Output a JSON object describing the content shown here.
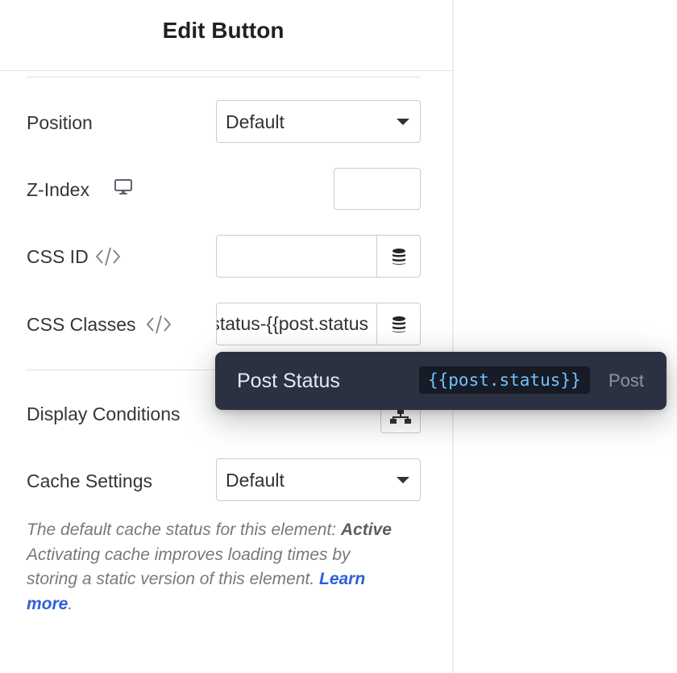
{
  "panel": {
    "title": "Edit Button"
  },
  "fields": {
    "position": {
      "label": "Position",
      "value": "Default"
    },
    "z_index": {
      "label": "Z-Index",
      "value": ""
    },
    "css_id": {
      "label": "CSS ID",
      "value": ""
    },
    "css_classes": {
      "label": "CSS Classes",
      "value": "status-{{post.status"
    },
    "display_conditions": {
      "label": "Display Conditions"
    },
    "cache_settings": {
      "label": "Cache Settings",
      "value": "Default"
    }
  },
  "help": {
    "line1_prefix": "The default cache status for this element: ",
    "status": "Active",
    "body": "Activating cache improves loading times by storing a static version of this element. ",
    "learn_more": "Learn more",
    "suffix": "."
  },
  "popup": {
    "title": "Post Status",
    "tag": "{{post.status}}",
    "group": "Post"
  },
  "icons": {
    "z_index": "desktop-icon",
    "css_id": "code-icon",
    "css_classes": "code-icon",
    "dynamic_data": "database-icon",
    "conditions": "sitemap-icon"
  },
  "colors": {
    "link": "#2f5fd8",
    "popup_bg": "#2c3142",
    "tag_text": "#6fc3ff"
  }
}
